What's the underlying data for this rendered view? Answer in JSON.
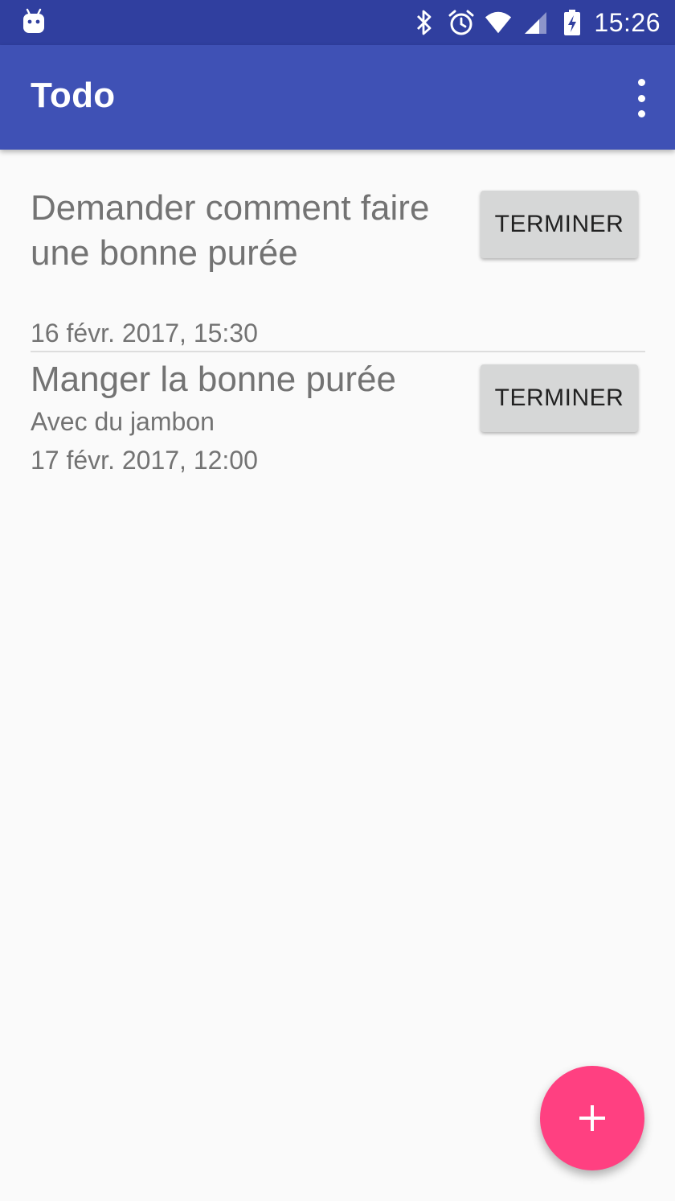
{
  "status_bar": {
    "time": "15:26",
    "icons": [
      "android-icon",
      "bluetooth-icon",
      "alarm-icon",
      "wifi-icon",
      "signal-icon",
      "battery-charging-icon"
    ]
  },
  "app_bar": {
    "title": "Todo",
    "menu_icon": "more-vert-icon"
  },
  "todos": [
    {
      "title": "Demander comment faire une bonne purée",
      "description": "",
      "date": "16 févr. 2017, 15:30",
      "button_label": "TERMINER"
    },
    {
      "title": "Manger la bonne purée",
      "description": "Avec du jambon",
      "date": "17 févr. 2017, 12:00",
      "button_label": "TERMINER"
    }
  ],
  "fab": {
    "icon": "add-icon"
  },
  "colors": {
    "status_bar": "#303f9f",
    "primary": "#3f51b5",
    "accent": "#ff4081",
    "background": "#fafafa",
    "text_secondary": "#737373",
    "button": "#d6d7d7"
  }
}
